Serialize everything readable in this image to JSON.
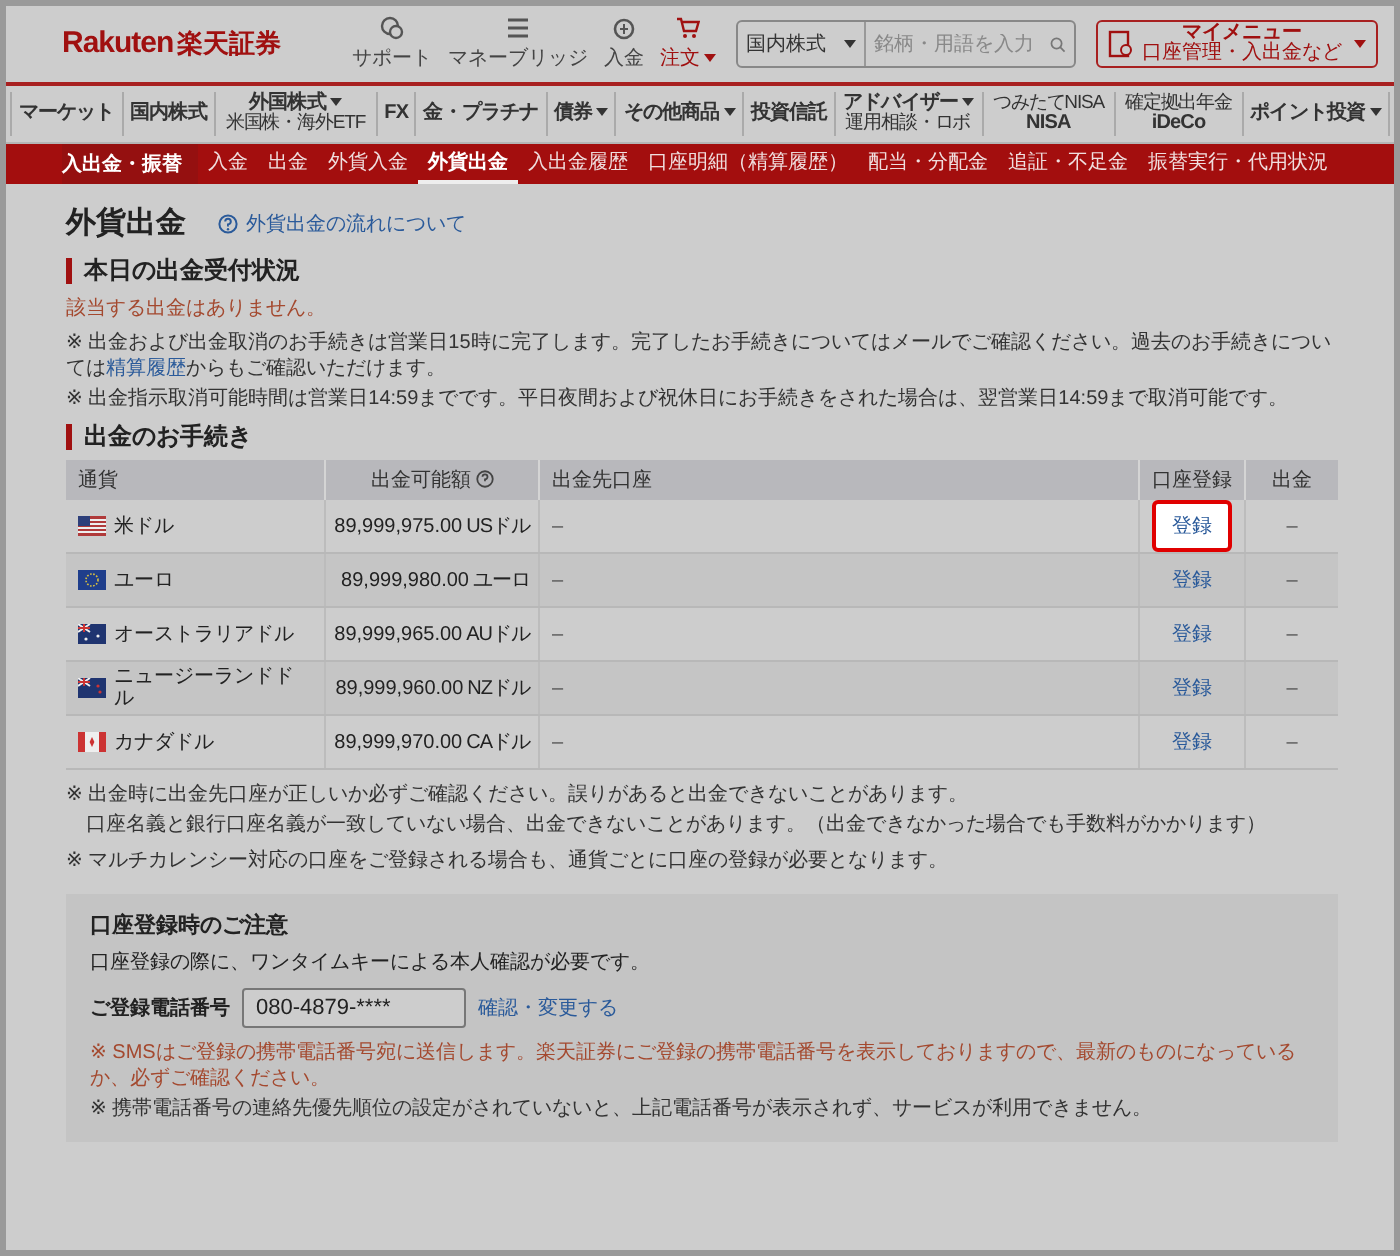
{
  "header": {
    "logo": "Rakuten",
    "logo_jp": "楽天証券",
    "utilities": [
      {
        "label": "サポート",
        "kind": "support",
        "dropdown": false
      },
      {
        "label": "マネーブリッジ",
        "kind": "bridge",
        "dropdown": false
      },
      {
        "label": "入金",
        "kind": "deposit",
        "dropdown": false
      },
      {
        "label": "注文",
        "kind": "order",
        "dropdown": true
      }
    ],
    "search": {
      "category": "国内株式",
      "placeholder": "銘柄・用語を入力"
    },
    "my_menu": {
      "label": "マイメニュー",
      "sub": "口座管理・入出金など"
    }
  },
  "nav": [
    {
      "label": "マーケット",
      "dropdown": false
    },
    {
      "label": "国内株式",
      "dropdown": false
    },
    {
      "label": "外国株式",
      "sub": "米国株・海外ETF",
      "dropdown": true
    },
    {
      "label": "FX",
      "dropdown": false
    },
    {
      "label": "金・プラチナ",
      "dropdown": false
    },
    {
      "label": "債券",
      "dropdown": true
    },
    {
      "label": "その他商品",
      "dropdown": true
    },
    {
      "label": "投資信託",
      "dropdown": false
    },
    {
      "label": "アドバイザー",
      "sub": "運用相談・ロボ",
      "dropdown": true
    },
    {
      "label": "NISA",
      "top": "つみたてNISA",
      "dropdown": false
    },
    {
      "label": "iDeCo",
      "top": "確定拠出年金",
      "dropdown": false
    },
    {
      "label": "ポイント投資",
      "dropdown": true
    }
  ],
  "subnav": {
    "title": "入出金・振替",
    "items": [
      {
        "label": "入金",
        "selected": false
      },
      {
        "label": "出金",
        "selected": false
      },
      {
        "label": "外貨入金",
        "selected": false
      },
      {
        "label": "外貨出金",
        "selected": true
      },
      {
        "label": "入出金履歴",
        "selected": false
      },
      {
        "label": "口座明細（精算履歴）",
        "selected": false
      },
      {
        "label": "配当・分配金",
        "selected": false
      },
      {
        "label": "追証・不足金",
        "selected": false
      },
      {
        "label": "振替実行・代用状況",
        "selected": false
      }
    ]
  },
  "page": {
    "title": "外貨出金",
    "help_link": "外貨出金の流れについて"
  },
  "status_section": {
    "heading": "本日の出金受付状況",
    "message": "該当する出金はありません。",
    "notes": [
      {
        "before": "※ 出金および出金取消のお手続きは営業日15時に完了します。完了したお手続きについてはメールでご確認ください。過去のお手続きについては",
        "link": "精算履歴",
        "after": "からもご確認いただけます。"
      },
      {
        "before": "※ 出金指示取消可能時間は営業日14:59までです。平日夜間および祝休日にお手続きをされた場合は、翌営業日14:59まで取消可能です。"
      }
    ]
  },
  "withdraw_section": {
    "heading": "出金のお手続き",
    "table": {
      "columns": [
        {
          "label": "通貨",
          "help": false
        },
        {
          "label": "出金可能額",
          "help": true
        },
        {
          "label": "出金先口座",
          "help": false
        },
        {
          "label": "口座登録",
          "help": false
        },
        {
          "label": "出金",
          "help": false
        }
      ],
      "rows": [
        {
          "kind": "us",
          "currency": "米ドル",
          "amount": "89,999,975.00",
          "unit": "USドル",
          "account": "–",
          "register": "登録",
          "highlighted": true,
          "withdraw": "–"
        },
        {
          "kind": "eu",
          "currency": "ユーロ",
          "amount": "89,999,980.00",
          "unit": "ユーロ",
          "account": "–",
          "register": "登録",
          "highlighted": false,
          "withdraw": "–"
        },
        {
          "kind": "au",
          "currency": "オーストラリアドル",
          "amount": "89,999,965.00",
          "unit": "AUドル",
          "account": "–",
          "register": "登録",
          "highlighted": false,
          "withdraw": "–"
        },
        {
          "kind": "nz",
          "currency": "ニュージーランドドル",
          "amount": "89,999,960.00",
          "unit": "NZドル",
          "account": "–",
          "register": "登録",
          "highlighted": false,
          "withdraw": "–"
        },
        {
          "kind": "ca",
          "currency": "カナダドル",
          "amount": "89,999,970.00",
          "unit": "CAドル",
          "account": "–",
          "register": "登録",
          "highlighted": false,
          "withdraw": "–"
        }
      ]
    },
    "notes": [
      {
        "lines": [
          "※ 出金時に出金先口座が正しいか必ずご確認ください。誤りがあると出金できないことがあります。",
          "口座名義と銀行口座名義が一致していない場合、出金できないことがあります。（出金できなかった場合でも手数料がかかります）"
        ]
      },
      {
        "lines": [
          "※ マルチカレンシー対応の口座をご登録される場合も、通貨ごとに口座の登録が必要となります。"
        ]
      }
    ]
  },
  "notice_box": {
    "title": "口座登録時のご注意",
    "text": "口座登録の際に、ワンタイムキーによる本人確認が必要です。",
    "phone_label": "ご登録電話番号",
    "phone_value": "080-4879-****",
    "phone_link": "確認・変更する",
    "notes": [
      {
        "kind": "warning",
        "text": "※ SMSはご登録の携帯電話番号宛に送信します。楽天証券にご登録の携帯電話番号を表示しておりますので、最新のものになっているか、必ずご確認ください。"
      },
      {
        "kind": "plain",
        "text": "※ 携帯電話番号の連絡先優先順位の設定がされていないと、上記電話番号が表示されず、サービスが利用できません。"
      }
    ]
  }
}
